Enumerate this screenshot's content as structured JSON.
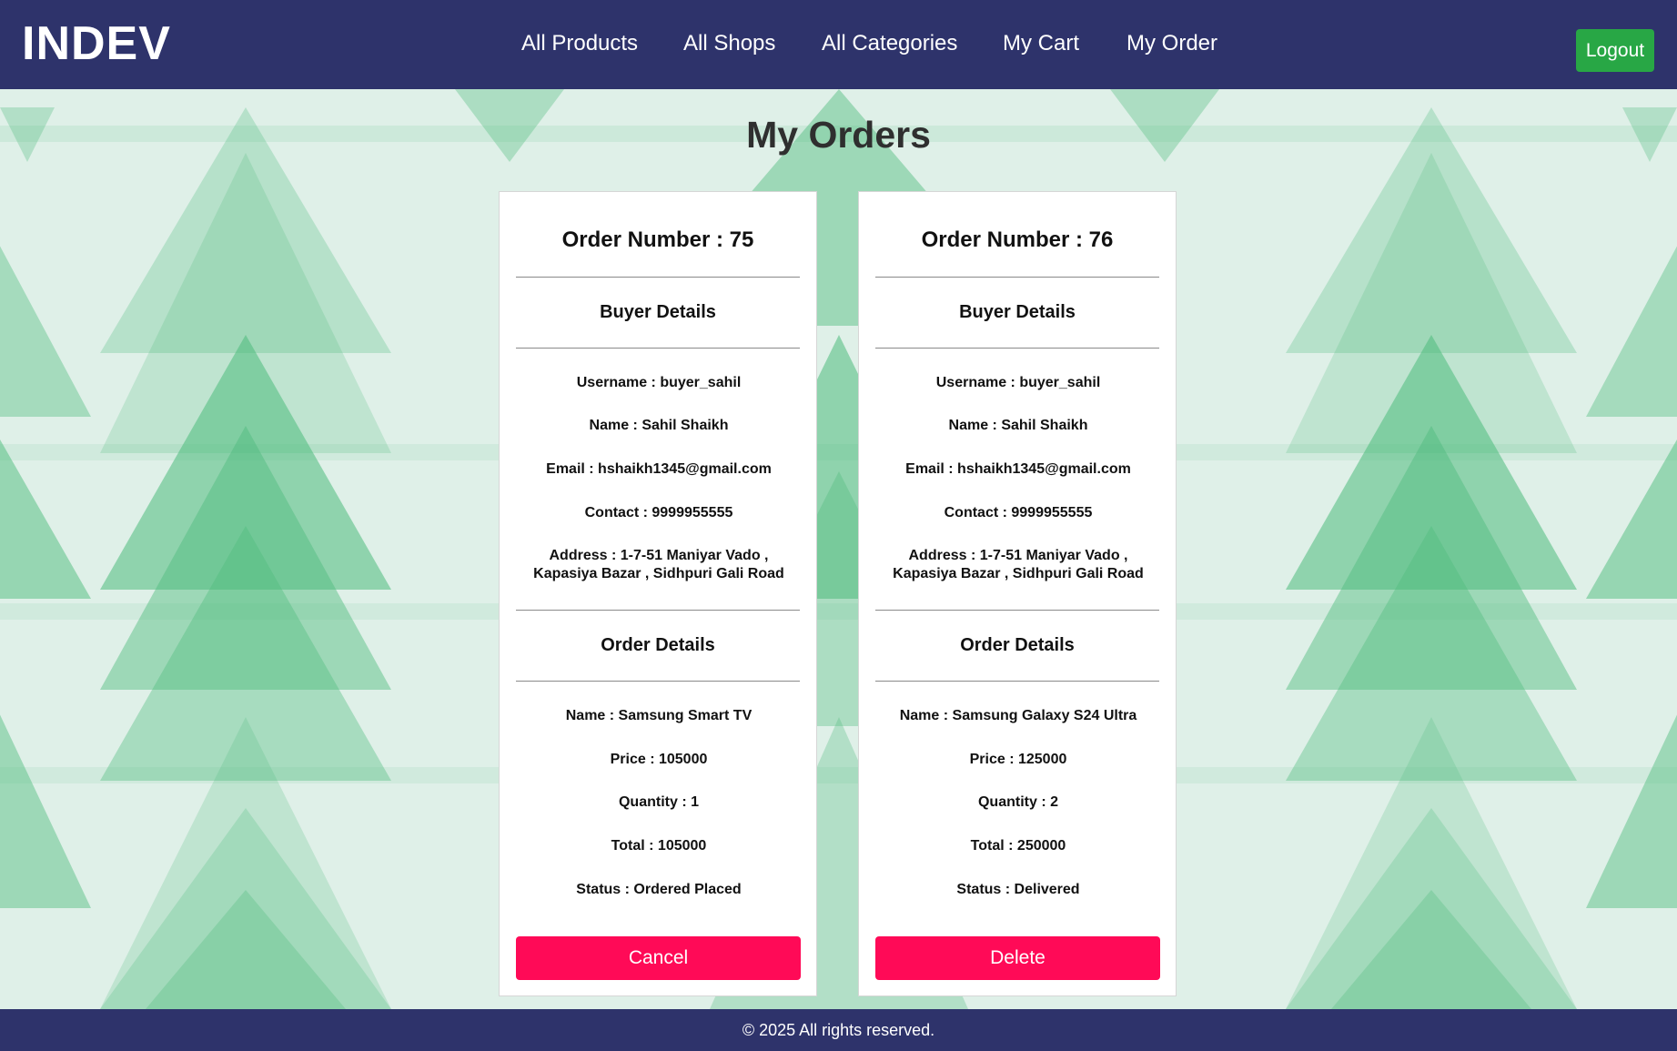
{
  "navbar": {
    "brand": "INDEV",
    "links": [
      {
        "label": "All Products"
      },
      {
        "label": "All Shops"
      },
      {
        "label": "All Categories"
      },
      {
        "label": "My Cart"
      },
      {
        "label": "My Order"
      }
    ],
    "logout_label": "Logout"
  },
  "page": {
    "title": "My Orders"
  },
  "orders": [
    {
      "order_number": "Order Number : 75",
      "buyer_heading": "Buyer Details",
      "username": "Username : buyer_sahil",
      "name": "Name : Sahil Shaikh",
      "email": "Email : hshaikh1345@gmail.com",
      "contact": "Contact : 9999955555",
      "address_line1": "Address : 1-7-51 Maniyar Vado ,",
      "address_line2": "Kapasiya Bazar , Sidhpuri Gali Road",
      "order_heading": "Order Details",
      "product_name": "Name : Samsung Smart TV",
      "price": "Price : 105000",
      "quantity": "Quantity : 1",
      "total": "Total : 105000",
      "status": "Status : Ordered Placed",
      "action_label": "Cancel"
    },
    {
      "order_number": "Order Number : 76",
      "buyer_heading": "Buyer Details",
      "username": "Username : buyer_sahil",
      "name": "Name : Sahil Shaikh",
      "email": "Email : hshaikh1345@gmail.com",
      "contact": "Contact : 9999955555",
      "address_line1": "Address : 1-7-51 Maniyar Vado ,",
      "address_line2": "Kapasiya Bazar , Sidhpuri Gali Road",
      "order_heading": "Order Details",
      "product_name": "Name : Samsung Galaxy S24 Ultra",
      "price": "Price : 125000",
      "quantity": "Quantity : 2",
      "total": "Total : 250000",
      "status": "Status : Delivered",
      "action_label": "Delete"
    }
  ],
  "footer": {
    "text": "© 2025 All rights reserved."
  },
  "colors": {
    "navbar_bg": "#2e336b",
    "logout_bg": "#28a745",
    "action_bg": "#ff0a57",
    "background_green": "#5fc48a",
    "card_bg": "#ffffff"
  },
  "icons": []
}
